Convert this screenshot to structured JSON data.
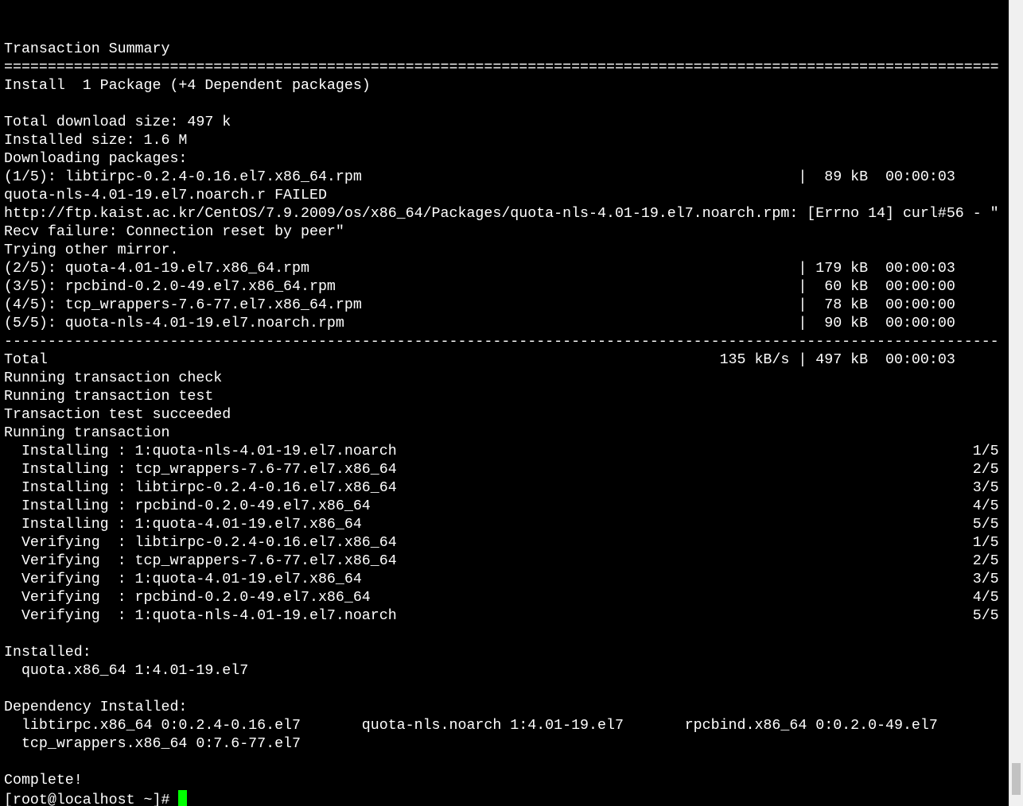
{
  "terminal": {
    "lines": [
      "",
      "Transaction Summary",
      "==================================================================================================================",
      "Install  1 Package (+4 Dependent packages)",
      "",
      "Total download size: 497 k",
      "Installed size: 1.6 M",
      "Downloading packages:",
      "(1/5): libtirpc-0.2.4-0.16.el7.x86_64.rpm                                                  |  89 kB  00:00:03",
      "quota-nls-4.01-19.el7.noarch.r FAILED",
      "http://ftp.kaist.ac.kr/CentOS/7.9.2009/os/x86_64/Packages/quota-nls-4.01-19.el7.noarch.rpm: [Errno 14] curl#56 - \"",
      "Recv failure: Connection reset by peer\"",
      "Trying other mirror.",
      "(2/5): quota-4.01-19.el7.x86_64.rpm                                                        | 179 kB  00:00:03",
      "(3/5): rpcbind-0.2.0-49.el7.x86_64.rpm                                                     |  60 kB  00:00:00",
      "(4/5): tcp_wrappers-7.6-77.el7.x86_64.rpm                                                  |  78 kB  00:00:00",
      "(5/5): quota-nls-4.01-19.el7.noarch.rpm                                                    |  90 kB  00:00:00",
      "------------------------------------------------------------------------------------------------------------------",
      "Total                                                                             135 kB/s | 497 kB  00:00:03",
      "Running transaction check",
      "Running transaction test",
      "Transaction test succeeded",
      "Running transaction",
      "  Installing : 1:quota-nls-4.01-19.el7.noarch                                                                  1/5",
      "  Installing : tcp_wrappers-7.6-77.el7.x86_64                                                                  2/5",
      "  Installing : libtirpc-0.2.4-0.16.el7.x86_64                                                                  3/5",
      "  Installing : rpcbind-0.2.0-49.el7.x86_64                                                                     4/5",
      "  Installing : 1:quota-4.01-19.el7.x86_64                                                                      5/5",
      "  Verifying  : libtirpc-0.2.4-0.16.el7.x86_64                                                                  1/5",
      "  Verifying  : tcp_wrappers-7.6-77.el7.x86_64                                                                  2/5",
      "  Verifying  : 1:quota-4.01-19.el7.x86_64                                                                      3/5",
      "  Verifying  : rpcbind-0.2.0-49.el7.x86_64                                                                     4/5",
      "  Verifying  : 1:quota-nls-4.01-19.el7.noarch                                                                  5/5",
      "",
      "Installed:",
      "  quota.x86_64 1:4.01-19.el7",
      "",
      "Dependency Installed:",
      "  libtirpc.x86_64 0:0.2.4-0.16.el7       quota-nls.noarch 1:4.01-19.el7       rpcbind.x86_64 0:0.2.0-49.el7",
      "  tcp_wrappers.x86_64 0:7.6-77.el7",
      "",
      "Complete!"
    ],
    "prompt": "[root@localhost ~]# ",
    "colors": {
      "background": "#000000",
      "foreground": "#ffffff",
      "cursor": "#00ff00"
    }
  }
}
